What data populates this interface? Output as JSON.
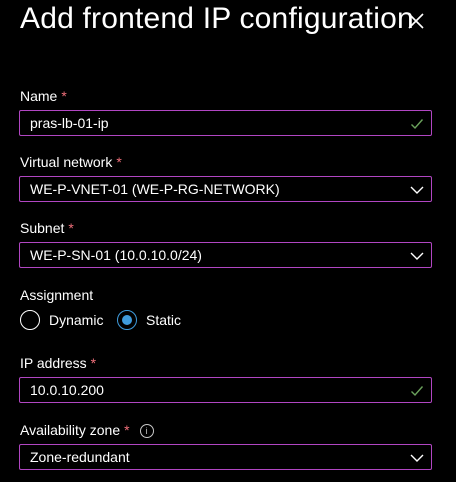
{
  "panel": {
    "title": "Add frontend IP configuration"
  },
  "fields": {
    "name": {
      "label": "Name",
      "required": "*",
      "value": "pras-lb-01-ip"
    },
    "virtual_network": {
      "label": "Virtual network",
      "required": "*",
      "value": "WE-P-VNET-01 (WE-P-RG-NETWORK)"
    },
    "subnet": {
      "label": "Subnet",
      "required": "*",
      "value": "WE-P-SN-01 (10.0.10.0/24)"
    },
    "assignment": {
      "label": "Assignment",
      "options": [
        "Dynamic",
        "Static"
      ],
      "selected": "Static"
    },
    "ip_address": {
      "label": "IP address",
      "required": "*",
      "value": "10.0.10.200"
    },
    "availability_zone": {
      "label": "Availability zone",
      "required": "*",
      "value": "Zone-redundant"
    }
  },
  "colors": {
    "background": "#000000",
    "field_border": "#b146c2",
    "valid_check": "#6ba25c",
    "radio_selected": "#3f9bdc",
    "required_star": "#f1707b"
  },
  "icons": {
    "close": "close-icon",
    "valid": "checkmark-icon",
    "dropdown": "chevron-down-icon",
    "info": "info-icon"
  }
}
